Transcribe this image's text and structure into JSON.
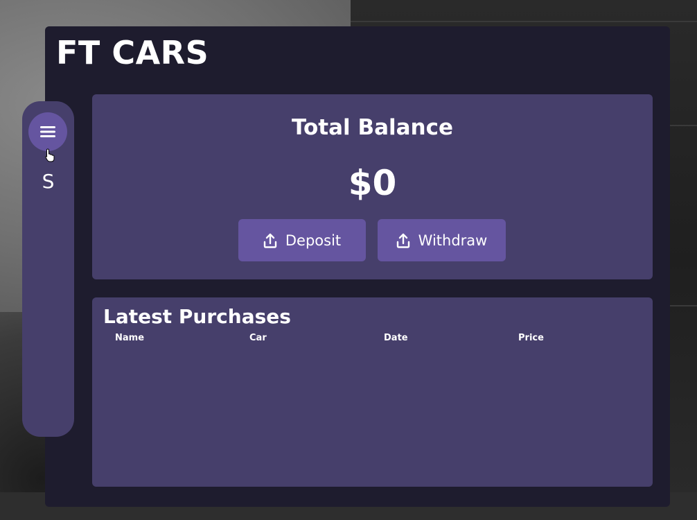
{
  "app": {
    "brand": "FT CARS"
  },
  "sidebar": {
    "menu_icon": "hamburger-menu-icon",
    "letter": "S"
  },
  "balance": {
    "title": "Total Balance",
    "amount": "$0",
    "deposit_label": "Deposit",
    "withdraw_label": "Withdraw",
    "deposit_icon": "upload-icon",
    "withdraw_icon": "upload-icon"
  },
  "purchases": {
    "title": "Latest Purchases",
    "columns": [
      "Name",
      "Car",
      "Date",
      "Price"
    ],
    "rows": []
  },
  "colors": {
    "panel_bg": "#1e1c2e",
    "card_bg": "#463f6b",
    "accent": "#6555a0",
    "text": "#ffffff"
  }
}
